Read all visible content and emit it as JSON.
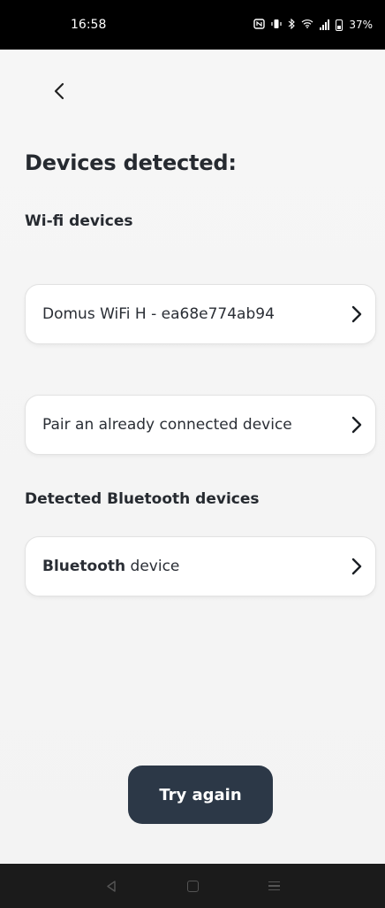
{
  "status_bar": {
    "time": "16:58",
    "nfc_icon": "nfc-icon",
    "vibrate_icon": "vibrate-icon",
    "bluetooth_icon": "bluetooth-icon",
    "wifi_icon": "wifi-icon",
    "signal_icon": "signal-icon",
    "battery_icon": "battery-icon",
    "battery_percent": "37%"
  },
  "header": {
    "back_icon": "chevron-left-icon",
    "title": "Devices detected:"
  },
  "wifi_section": {
    "title": "Wi-fi devices",
    "devices": [
      {
        "label": "Domus WiFi H - ea68e774ab94"
      }
    ],
    "pair_existing_label": "Pair an already connected device"
  },
  "bluetooth_section": {
    "title": "Detected Bluetooth devices",
    "devices": [
      {
        "label_bold": "Bluetooth",
        "label_rest": " device"
      }
    ]
  },
  "actions": {
    "try_again_label": "Try again"
  },
  "nav_bar": {
    "back_icon": "triangle-back-icon",
    "home_icon": "square-home-icon",
    "recents_icon": "recents-menu-icon"
  },
  "colors": {
    "background": "#f4f4f4",
    "card_background": "#ffffff",
    "button_primary": "#2c3847",
    "text_primary": "#262a30"
  }
}
